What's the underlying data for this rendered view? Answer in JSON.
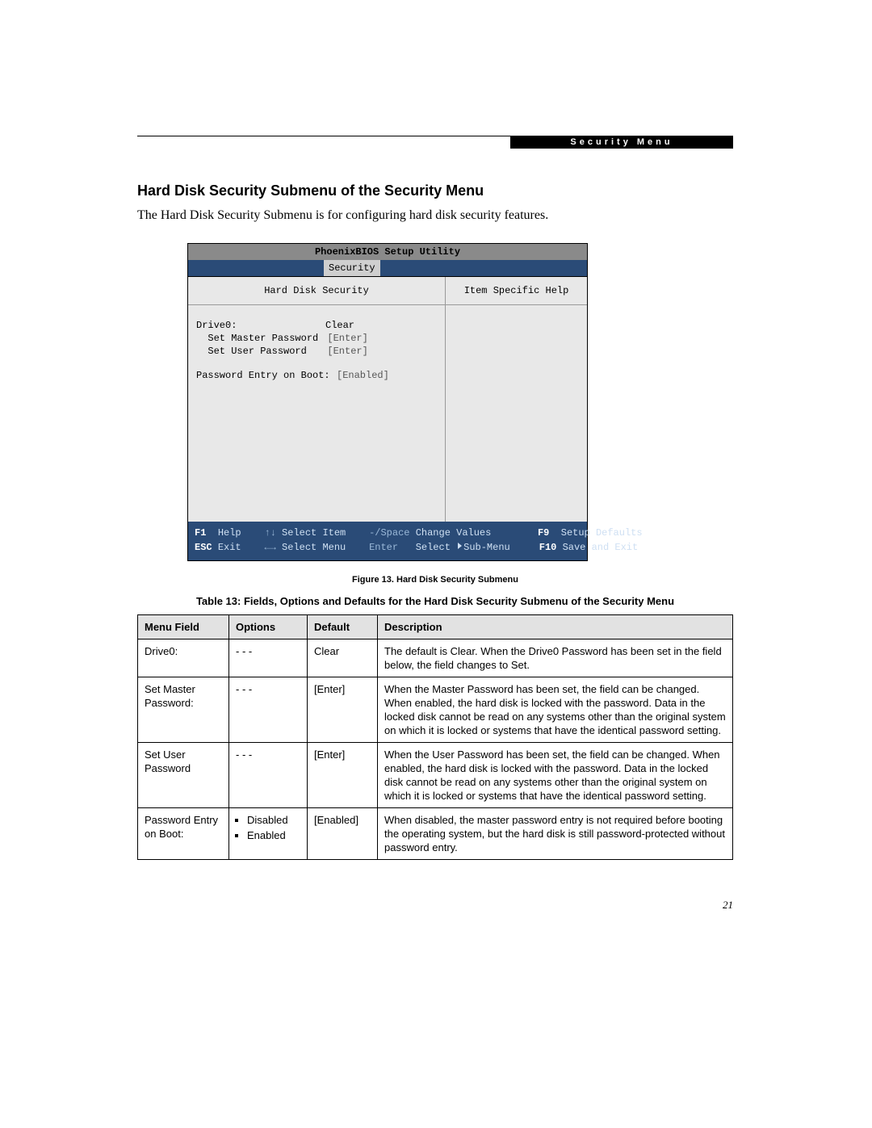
{
  "chapter": "Security Menu",
  "heading": "Hard Disk Security Submenu of the Security Menu",
  "intro": "The Hard Disk Security Submenu is for configuring hard disk security features.",
  "bios": {
    "title": "PhoenixBIOS Setup Utility",
    "active_tab": "Security",
    "left_header": "Hard Disk Security",
    "right_header": "Item Specific Help",
    "rows": {
      "drive0_label": "Drive0:",
      "drive0_value": "Clear",
      "master_label": "Set Master Password",
      "master_value": "[Enter]",
      "user_label": "Set User Password",
      "user_value": "[Enter]",
      "peb_label": "Password Entry on Boot:",
      "peb_value": "[Enabled]"
    },
    "footer": {
      "f1": "F1",
      "help": "Help",
      "updown": "↑↓",
      "select_item": "Select Item",
      "pmspace": "-/Space",
      "change_values": "Change Values",
      "f9": "F9",
      "setup_defaults": "Setup Defaults",
      "esc": "ESC",
      "exit": "Exit",
      "lr": "←→",
      "select_menu": "Select Menu",
      "enter": "Enter",
      "select_sub": "Select",
      "submenu": "Sub-Menu",
      "f10": "F10",
      "save_exit": "Save and Exit"
    }
  },
  "fig_caption": "Figure 13.   Hard Disk Security Submenu",
  "table_caption": "Table 13: Fields, Options and Defaults for the Hard Disk Security Submenu of the Security Menu",
  "table": {
    "headers": {
      "mf": "Menu Field",
      "op": "Options",
      "df": "Default",
      "de": "Description"
    },
    "rows": [
      {
        "mf": "Drive0:",
        "op": "- - -",
        "df": "Clear",
        "de": "The default is Clear. When the Drive0 Password has been set in the field below, the field changes to Set."
      },
      {
        "mf": "Set Master Password:",
        "op": "- - -",
        "df": "[Enter]",
        "de": "When the Master Password has been set, the field can be changed. When enabled, the hard disk is locked with the password. Data in the locked disk cannot be read on any systems other than the original system on which it is locked or systems that have the identical password setting."
      },
      {
        "mf": "Set User Password",
        "op": "- - -",
        "df": "[Enter]",
        "de": "When the User Password has been set, the field can be changed. When enabled, the hard disk is locked with the password. Data in the locked disk cannot be read on any systems other than the original system on which it is locked or systems that have the identical password setting."
      },
      {
        "mf": "Password Entry on Boot:",
        "op_list": [
          "Disabled",
          "Enabled"
        ],
        "df": "[Enabled]",
        "de": "When disabled, the master password entry is not required before booting the operating system, but the hard disk is still password-protected without password entry."
      }
    ]
  },
  "page_number": "21"
}
